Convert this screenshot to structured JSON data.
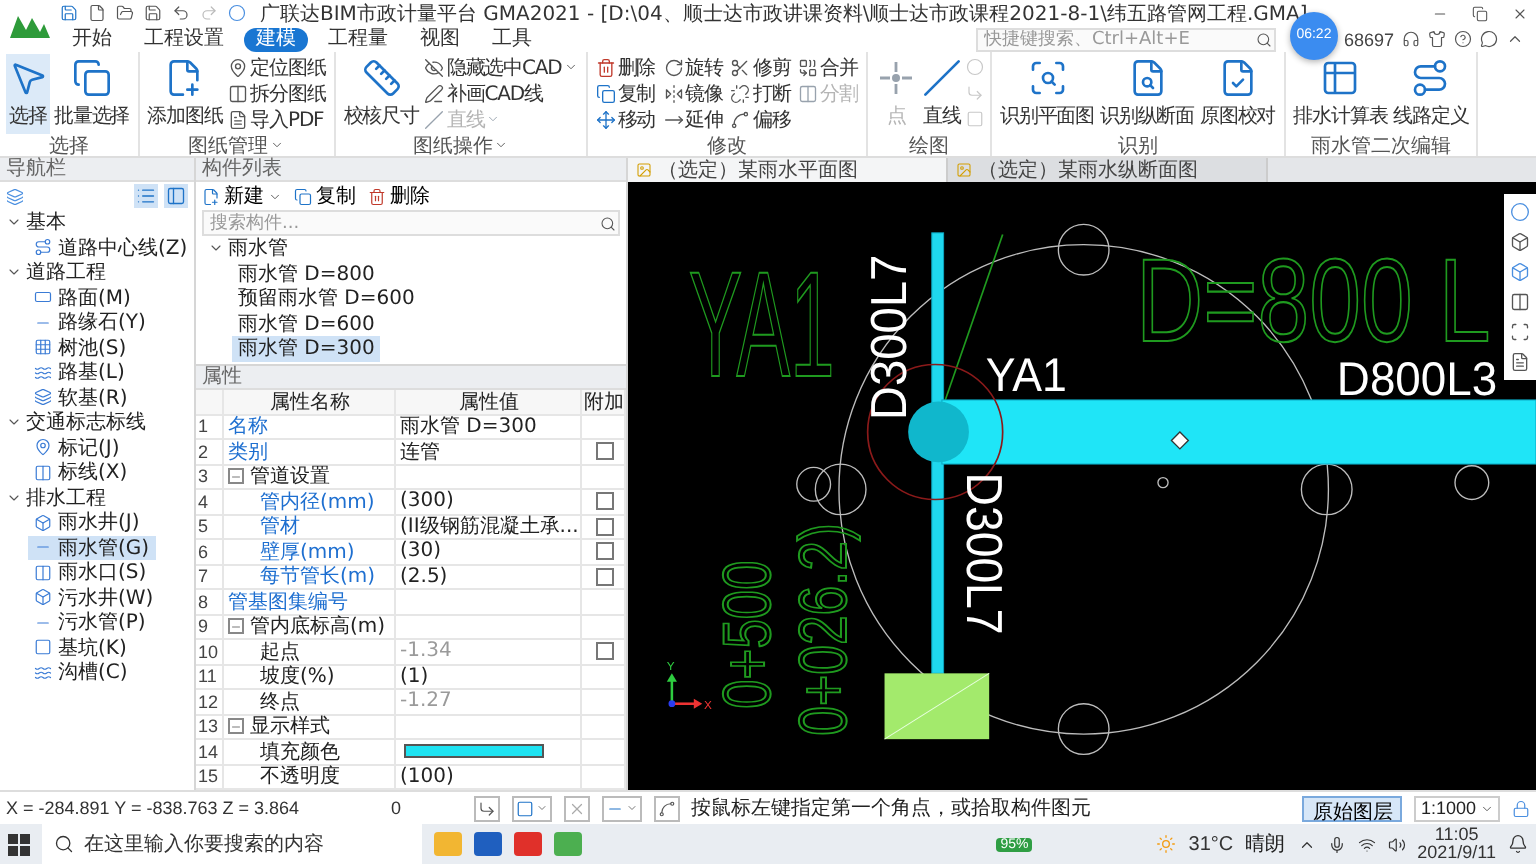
{
  "app": {
    "title": "广联达BIM市政计量平台 GMA2021 - [D:\\04、顺士达市政讲课资料\\顺士达市政课程2021-8-1\\纬五路管网工程.GMA]",
    "quick_search": {
      "placeholder": "快捷键搜索、Ctrl+Alt+E"
    },
    "user_id": "68697",
    "recorder_badge": "06:22"
  },
  "menu_tabs": [
    {
      "label": "开始",
      "selected": false
    },
    {
      "label": "工程设置",
      "selected": false
    },
    {
      "label": "建模",
      "selected": true
    },
    {
      "label": "工程量",
      "selected": false
    },
    {
      "label": "视图",
      "selected": false
    },
    {
      "label": "工具",
      "selected": false
    }
  ],
  "ribbon": [
    {
      "label": "选择",
      "buttons": [
        {
          "label": "选择",
          "kind": "large",
          "selected": true,
          "disabled": false
        },
        {
          "label": "批量选择",
          "kind": "large",
          "selected": false,
          "disabled": false
        }
      ]
    },
    {
      "label": "图纸管理",
      "menu": true,
      "buttons": [
        {
          "label": "添加图纸",
          "kind": "large",
          "disabled": false
        },
        {
          "label": "定位图纸",
          "kind": "small",
          "disabled": false
        },
        {
          "label": "拆分图纸",
          "kind": "small",
          "disabled": false
        },
        {
          "label": "导入PDF",
          "kind": "small",
          "disabled": false
        }
      ]
    },
    {
      "label": "图纸操作",
      "menu": true,
      "buttons": [
        {
          "label": "校核尺寸",
          "kind": "large",
          "disabled": false
        },
        {
          "label": "隐藏选中CAD",
          "kind": "small",
          "disabled": false,
          "dropdown": true
        },
        {
          "label": "补画CAD线",
          "kind": "small",
          "disabled": false
        },
        {
          "label": "直线",
          "kind": "small",
          "disabled": true,
          "dropdown": true
        }
      ]
    },
    {
      "label": "修改",
      "buttons": [
        {
          "label": "删除",
          "kind": "small",
          "disabled": false
        },
        {
          "label": "复制",
          "kind": "small",
          "disabled": false
        },
        {
          "label": "移动",
          "kind": "small",
          "disabled": false
        },
        {
          "label": "旋转",
          "kind": "small",
          "disabled": false
        },
        {
          "label": "镜像",
          "kind": "small",
          "disabled": false
        },
        {
          "label": "延伸",
          "kind": "small",
          "disabled": false
        },
        {
          "label": "修剪",
          "kind": "small",
          "disabled": false
        },
        {
          "label": "打断",
          "kind": "small",
          "disabled": false
        },
        {
          "label": "偏移",
          "kind": "small",
          "disabled": false
        },
        {
          "label": "合并",
          "kind": "small",
          "disabled": false
        },
        {
          "label": "分割",
          "kind": "small",
          "disabled": true
        }
      ]
    },
    {
      "label": "绘图",
      "buttons": [
        {
          "label": "点",
          "kind": "large",
          "disabled": true
        },
        {
          "label": "直线",
          "kind": "large",
          "disabled": false
        }
      ]
    },
    {
      "label": "识别",
      "buttons": [
        {
          "label": "识别平面图",
          "kind": "large",
          "disabled": false
        },
        {
          "label": "识别纵断面",
          "kind": "large",
          "disabled": false
        },
        {
          "label": "原图校对",
          "kind": "large",
          "disabled": false
        }
      ]
    },
    {
      "label": "雨水管二次编辑",
      "buttons": [
        {
          "label": "排水计算表",
          "kind": "large",
          "disabled": false
        },
        {
          "label": "线路定义",
          "kind": "large",
          "disabled": false
        }
      ]
    }
  ],
  "nav": {
    "title": "导航栏",
    "groups": [
      {
        "label": "基本",
        "expanded": true,
        "children": [
          {
            "label": "道路中心线(Z)",
            "selected": false
          }
        ]
      },
      {
        "label": "道路工程",
        "expanded": true,
        "children": [
          {
            "label": "路面(M)",
            "selected": false
          },
          {
            "label": "路缘石(Y)",
            "selected": false
          },
          {
            "label": "树池(S)",
            "selected": false
          },
          {
            "label": "路基(L)",
            "selected": false
          },
          {
            "label": "软基(R)",
            "selected": false
          }
        ]
      },
      {
        "label": "交通标志标线",
        "expanded": true,
        "children": [
          {
            "label": "标记(J)",
            "selected": false
          },
          {
            "label": "标线(X)",
            "selected": false
          }
        ]
      },
      {
        "label": "排水工程",
        "expanded": true,
        "children": [
          {
            "label": "雨水井(J)",
            "selected": false
          },
          {
            "label": "雨水管(G)",
            "selected": true
          },
          {
            "label": "雨水口(S)",
            "selected": false
          },
          {
            "label": "污水井(W)",
            "selected": false
          },
          {
            "label": "污水管(P)",
            "selected": false
          },
          {
            "label": "基坑(K)",
            "selected": false
          },
          {
            "label": "沟槽(C)",
            "selected": false
          }
        ]
      }
    ]
  },
  "components": {
    "title": "构件列表",
    "actions": [
      {
        "label": "新建",
        "dropdown": true
      },
      {
        "label": "复制"
      },
      {
        "label": "删除"
      }
    ],
    "search": {
      "placeholder": "搜索构件..."
    },
    "tree": [
      {
        "label": "雨水管",
        "expanded": true,
        "children": [
          {
            "label": "雨水管 D=800",
            "selected": false
          },
          {
            "label": "预留雨水管 D=600",
            "selected": false
          },
          {
            "label": "雨水管 D=600",
            "selected": false
          },
          {
            "label": "雨水管 D=300",
            "selected": true
          }
        ]
      }
    ]
  },
  "properties": {
    "title": "属性",
    "columns": [
      "属性名称",
      "属性值",
      "附加"
    ],
    "rows": [
      {
        "no": "1",
        "name": "名称",
        "value": "雨水管 D=300",
        "kind": "item",
        "link": true
      },
      {
        "no": "2",
        "name": "类别",
        "value": "连管",
        "kind": "check",
        "link": true,
        "checked": false
      },
      {
        "no": "3",
        "name": "管道设置",
        "kind": "group",
        "expanded": true,
        "children": [
          {
            "no": "4",
            "name": "管内径(mm)",
            "value": "(300)",
            "kind": "check",
            "link": true,
            "checked": false
          },
          {
            "no": "5",
            "name": "管材",
            "value": "(II级钢筋混凝土承...",
            "kind": "check",
            "link": true,
            "checked": false
          },
          {
            "no": "6",
            "name": "壁厚(mm)",
            "value": "(30)",
            "kind": "check",
            "link": true,
            "checked": false
          },
          {
            "no": "7",
            "name": "每节管长(m)",
            "value": "(2.5)",
            "kind": "check",
            "link": true,
            "checked": false
          }
        ]
      },
      {
        "no": "8",
        "name": "管基图集编号",
        "kind": "item",
        "link": true
      },
      {
        "no": "9",
        "name": "管内底标高(m)",
        "kind": "group",
        "expanded": true,
        "children": [
          {
            "no": "10",
            "name": "起点",
            "value": "-1.34",
            "kind": "check",
            "link": false,
            "muted": true,
            "checked": false
          },
          {
            "no": "11",
            "name": "坡度(%)",
            "value": "(1)",
            "kind": "item",
            "link": false
          },
          {
            "no": "12",
            "name": "终点",
            "value": "-1.27",
            "kind": "item",
            "link": false,
            "muted": true
          }
        ]
      },
      {
        "no": "13",
        "name": "显示样式",
        "kind": "group",
        "expanded": true,
        "children": [
          {
            "no": "14",
            "name": "填充颜色",
            "kind": "swatch",
            "color": "#1ee3f2",
            "link": false
          },
          {
            "no": "15",
            "name": "不透明度",
            "value": "(100)",
            "kind": "item",
            "link": false
          }
        ]
      }
    ]
  },
  "canvas": {
    "tabs": [
      {
        "label": "（选定）某雨水平面图",
        "selected": true
      },
      {
        "label": "（选定）某雨水纵断面图",
        "selected": false
      }
    ],
    "labels": [
      {
        "text": "YA1",
        "kind": "cad"
      },
      {
        "text": "D300L7",
        "kind": "pipe"
      },
      {
        "text": "YA1",
        "kind": "pipe"
      },
      {
        "text": "D=800 L",
        "kind": "cad"
      },
      {
        "text": "D800L3",
        "kind": "pipe"
      },
      {
        "text": "0+500",
        "kind": "cad"
      },
      {
        "text": "0+026.2)",
        "kind": "cad"
      },
      {
        "text": "D300L7",
        "kind": "pipe"
      }
    ],
    "axis": {
      "x": "X",
      "y": "Y"
    }
  },
  "status": {
    "coords": "X = -284.891 Y = -838.763 Z = 3.864",
    "value": "0",
    "hint": "按鼠标左键指定第一个角点，或拾取构件图元",
    "layer_button": {
      "label": "原始图层",
      "selected": true
    },
    "scale": "1:1000"
  },
  "taskbar": {
    "search_placeholder": "在这里输入你要搜索的内容",
    "battery": "95%",
    "temperature": "31°C",
    "weather": "晴朗",
    "time": "11:05",
    "date": "2021/9/11"
  }
}
